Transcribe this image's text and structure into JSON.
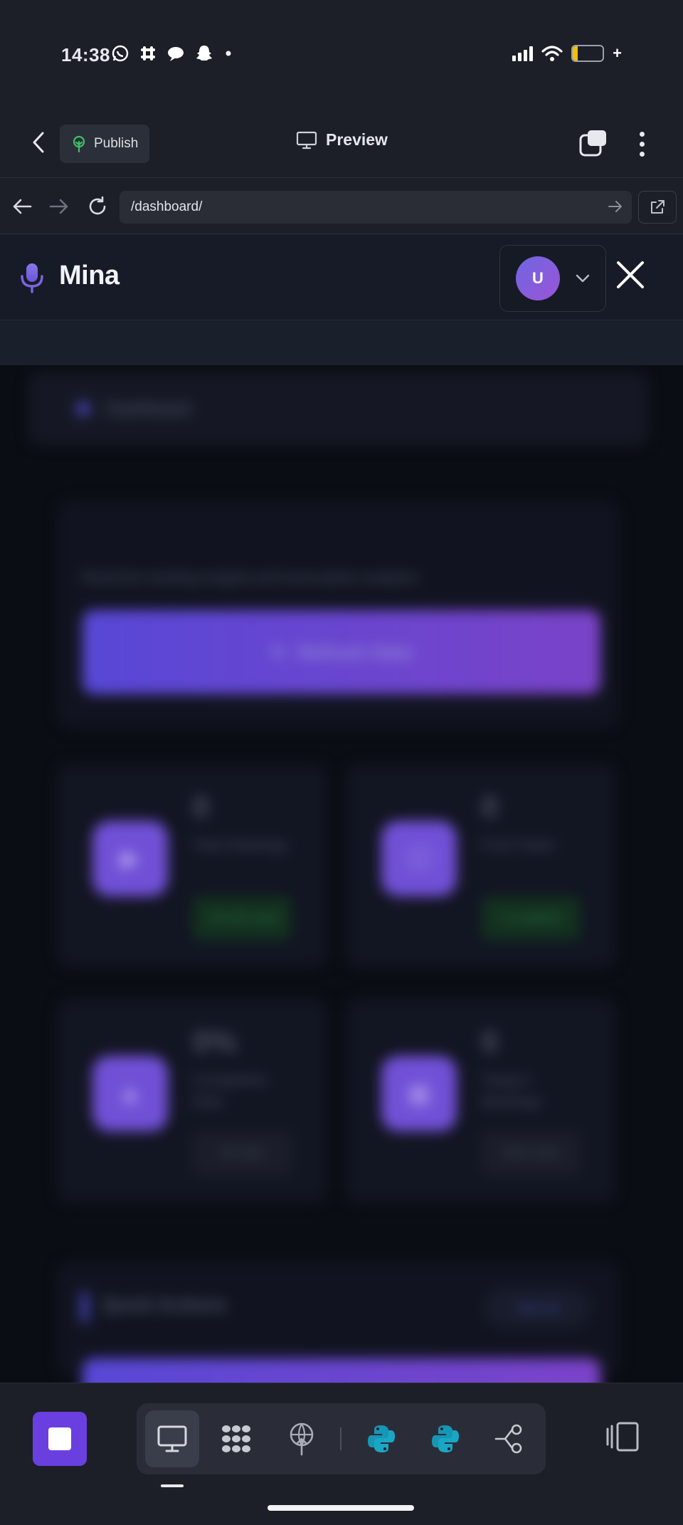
{
  "status_bar": {
    "time": "14:38",
    "notification_icons": [
      "whatsapp-icon",
      "slack-icon",
      "chat-icon",
      "snapchat-icon",
      "dot-icon"
    ],
    "battery_level": "17",
    "battery_percent": 17,
    "signal_bars": 4,
    "charging": true
  },
  "editor_bar": {
    "publish_label": "Publish",
    "preview_label": "Preview"
  },
  "browser": {
    "url": "/dashboard/"
  },
  "app": {
    "brand": "Mina",
    "avatar_initial": "U"
  },
  "dashboard": {
    "breadcrumb": "Dashboard",
    "hero_subtitle": "Real-time meeting insights and transcription analytics",
    "refresh_label": "Refresh Data",
    "stats": [
      {
        "value": "0",
        "label": "Total Meetings",
        "badge": "+0% this week",
        "badge_style": "green",
        "icon": "video-icon"
      },
      {
        "value": "0",
        "label": "Final Tasks",
        "badge": "0 completed",
        "badge_style": "green",
        "icon": "task-icon"
      },
      {
        "value": "0%",
        "label": "Completion Rate",
        "badge": "On track",
        "badge_style": "gray",
        "icon": "chart-icon"
      },
      {
        "value": "0",
        "label": "Today's Meetings",
        "badge": "Next: none",
        "badge_style": "gray",
        "icon": "calendar-icon"
      }
    ],
    "quick_actions_title": "Quick Actions",
    "quick_actions_link": "View all"
  },
  "colors": {
    "accent": "#6a3fe0",
    "brand_gradient_start": "#5848d6",
    "brand_gradient_end": "#7a43c8",
    "success": "#2f8a4c",
    "python": "#1597b5"
  },
  "toolbar": {
    "tools": [
      "desktop-icon",
      "dots-grid-icon",
      "publish-globe-icon",
      "python-icon",
      "python-icon",
      "flow-icon"
    ],
    "active_tool": "desktop-icon"
  }
}
